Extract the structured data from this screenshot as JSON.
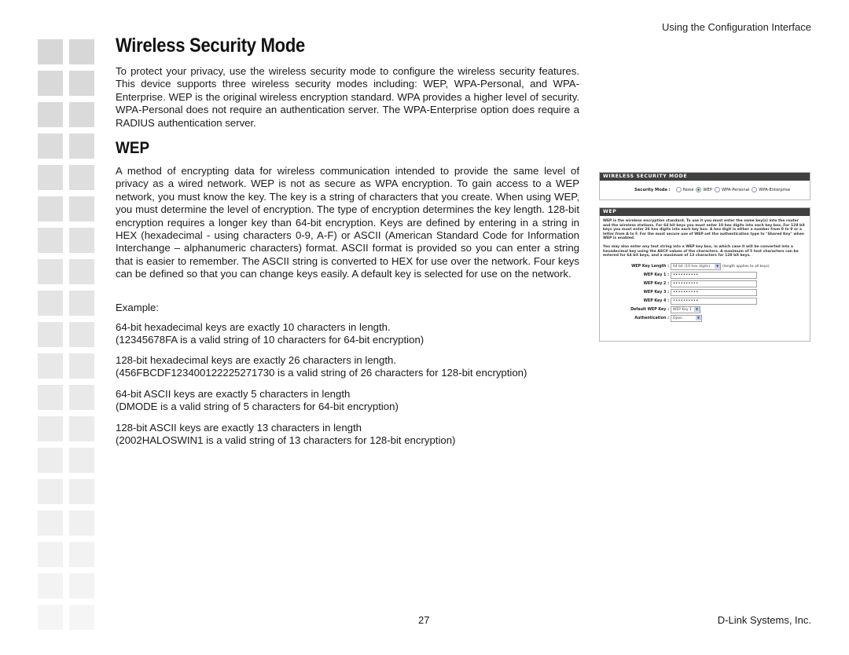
{
  "header": {
    "section": "Using the Configuration Interface"
  },
  "page_title": "Wireless Security Mode",
  "intro": "To protect your privacy, use the wireless security mode to configure the wireless security features. This device supports three wireless security modes including: WEP, WPA-Personal, and WPA-Enterprise. WEP is the original wireless encryption standard. WPA provides a higher level of security. WPA-Personal does not require an authentication server. The WPA-Enterprise option does require a RADIUS authentication server.",
  "wep_heading": "WEP",
  "wep_body": "A method of encrypting data for wireless communication intended to provide the same level of privacy as a wired network. WEP is not as secure as WPA encryption. To gain access to a WEP network, you must know the key. The key is a string of characters that you create. When using WEP, you must determine the level of encryption. The type of encryption determines the key length. 128-bit encryption requires a longer key than 64-bit encryption. Keys are defined by entering in a string in HEX (hexadecimal - using characters 0-9, A-F) or ASCII (American Standard Code for Information Interchange – alphanumeric characters) format. ASCII format is provided so you can enter a string that is easier to remember. The ASCII string is converted to HEX for use over the network. Four keys can be defined so that you can change keys easily. A default key is selected for use on the network.",
  "example_label": "Example:",
  "examples": [
    {
      "line1": "64-bit hexadecimal keys are exactly 10 characters in length.",
      "line2": "(12345678FA is a valid string of 10 characters for 64-bit encryption)"
    },
    {
      "line1": "128-bit hexadecimal keys are exactly 26 characters in length.",
      "line2": "(456FBCDF123400122225271730 is a valid string of 26 characters for 128-bit encryption)"
    },
    {
      "line1": "64-bit ASCII keys are exactly 5 characters in length",
      "line2": "(DMODE is a valid string of 5 characters for 64-bit encryption)"
    },
    {
      "line1": "128-bit ASCII keys are exactly 13 characters in length",
      "line2": "(2002HALOSWIN1 is a valid string of 13 characters for 128-bit encryption)"
    }
  ],
  "screenshot": {
    "mode_panel_title": "WIRELESS SECURITY MODE",
    "mode_label": "Security Mode :",
    "modes": [
      {
        "label": "None",
        "selected": false
      },
      {
        "label": "WEP",
        "selected": true
      },
      {
        "label": "WPA-Personal",
        "selected": false
      },
      {
        "label": "WPA-Enterprise",
        "selected": false
      }
    ],
    "wep_panel_title": "WEP",
    "wep_desc_1": "WEP is the wireless encryption standard. To use it you must enter the same key(s) into the router and the wireless stations. For 64 bit keys you must enter 10 hex digits into each key box. For 128 bit keys you must enter 26 hex digits into each key box. A hex digit is either a number from 0 to 9 or a letter from A to F. For the most secure use of WEP set the authentication type to \"Shared Key\" when WEP is enabled.",
    "wep_desc_2": "You may also enter any text string into a WEP key box, in which case it will be converted into a hexadecimal key using the ASCII values of the characters. A maximum of 5 text characters can be entered for 64 bit keys, and a maximum of 13 characters for 128 bit keys.",
    "key_length_label": "WEP Key Length :",
    "key_length_value": "64 bit (10 hex digits)",
    "key_length_note": "(length applies to all keys)",
    "keys": [
      {
        "label": "WEP Key 1 :",
        "value": "••••••••••"
      },
      {
        "label": "WEP Key 2 :",
        "value": "••••••••••"
      },
      {
        "label": "WEP Key 3 :",
        "value": "••••••••••"
      },
      {
        "label": "WEP Key 4 :",
        "value": "••••••••••"
      }
    ],
    "default_key_label": "Default WEP Key :",
    "default_key_value": "WEP Key 1",
    "auth_label": "Authentication :",
    "auth_value": "Open"
  },
  "footer": {
    "page_number": "27",
    "company": "D-Link Systems, Inc."
  }
}
